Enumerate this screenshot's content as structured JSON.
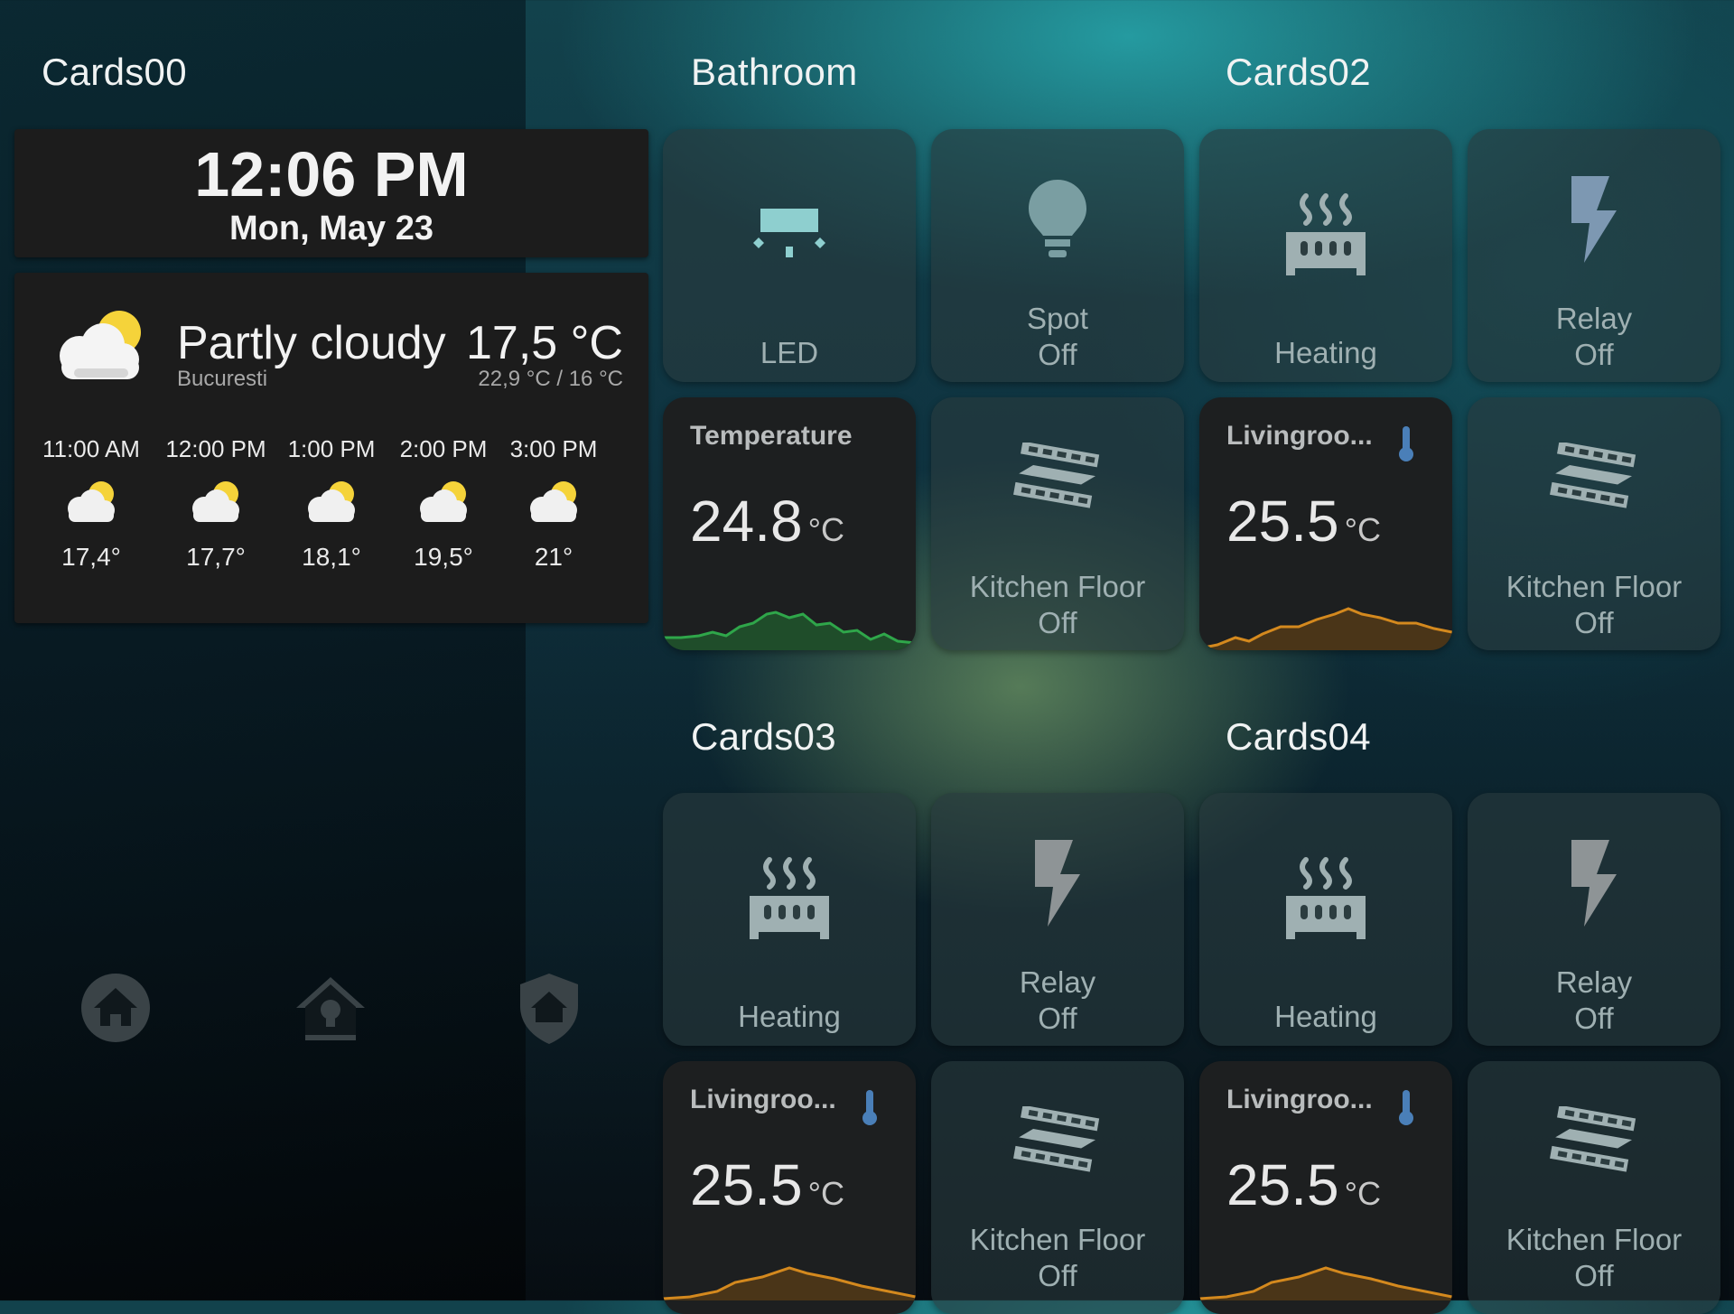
{
  "sections": {
    "cards00": "Cards00",
    "bathroom": "Bathroom",
    "cards02": "Cards02",
    "cards03": "Cards03",
    "cards04": "Cards04"
  },
  "clock": {
    "time": "12:06 PM",
    "date": "Mon, May 23"
  },
  "weather": {
    "condition": "Partly cloudy",
    "location": "Bucuresti",
    "temperature": "17,5 °C",
    "range": "22,9 °C / 16 °C",
    "icon": "partly-cloudy-icon",
    "forecast": [
      {
        "time": "11:00 AM",
        "temp": "17,4°"
      },
      {
        "time": "12:00 PM",
        "temp": "17,7°"
      },
      {
        "time": "1:00 PM",
        "temp": "18,1°"
      },
      {
        "time": "2:00 PM",
        "temp": "19,5°"
      },
      {
        "time": "3:00 PM",
        "temp": "21°"
      }
    ]
  },
  "nav": [
    "home-icon",
    "home-lightbulb-icon",
    "home-shield-icon"
  ],
  "tiles": {
    "led": {
      "label": "LED",
      "icon": "ceiling-light-icon"
    },
    "spot": {
      "name": "Spot",
      "state": "Off",
      "icon": "lightbulb-icon"
    },
    "heating1": {
      "label": "Heating",
      "icon": "radiator-icon"
    },
    "relay1": {
      "name": "Relay",
      "state": "Off",
      "icon": "flash-icon"
    },
    "temperature": {
      "name": "Temperature",
      "value": "24.8",
      "unit": "°C"
    },
    "kitchen1": {
      "name": "Kitchen Floor",
      "state": "Off",
      "icon": "heated-floor-icon"
    },
    "living1": {
      "name": "Livingroo...",
      "value": "25.5",
      "unit": "°C"
    },
    "kitchen2": {
      "name": "Kitchen Floor",
      "state": "Off",
      "icon": "heated-floor-icon"
    },
    "heating2": {
      "label": "Heating",
      "icon": "radiator-icon"
    },
    "relay2": {
      "name": "Relay",
      "state": "Off",
      "icon": "flash-icon"
    },
    "heating3": {
      "label": "Heating",
      "icon": "radiator-icon"
    },
    "relay3": {
      "name": "Relay",
      "state": "Off",
      "icon": "flash-icon"
    },
    "living2": {
      "name": "Livingroo...",
      "value": "25.5",
      "unit": "°C"
    },
    "kitchen3": {
      "name": "Kitchen Floor",
      "state": "Off",
      "icon": "heated-floor-icon"
    },
    "living3": {
      "name": "Livingroo...",
      "value": "25.5",
      "unit": "°C"
    },
    "kitchen4": {
      "name": "Kitchen Floor",
      "state": "Off",
      "icon": "heated-floor-icon"
    }
  },
  "colors": {
    "sparkline_green": "#2fa64a",
    "sparkline_orange": "#d4891e",
    "sun_yellow": "#f5d33a",
    "thermometer_blue": "#4a7fb8"
  }
}
